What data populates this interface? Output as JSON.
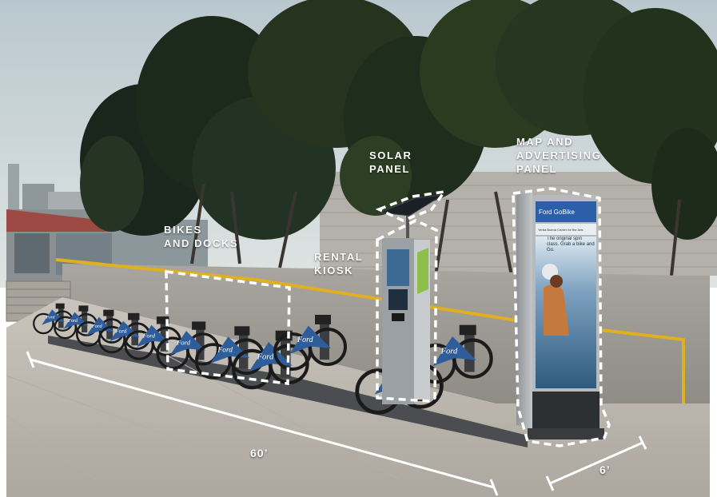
{
  "labels": {
    "bikes_docks": [
      "BIKES",
      "AND DOCKS"
    ],
    "rental_kiosk": [
      "RENTAL",
      "KIOSK"
    ],
    "solar_panel": [
      "SOLAR",
      "PANEL"
    ],
    "map_panel": [
      "MAP AND",
      "ADVERTISING",
      "PANEL"
    ]
  },
  "dimensions": {
    "length": "60’",
    "width": "6’"
  },
  "bike_brand": "Ford",
  "ad_panel": {
    "brand": "Ford GoBike",
    "subtitle": "Yerba Buena Center for the Arts",
    "headline": "The original spin class. Grab a bike and Go."
  },
  "colors": {
    "bike_blue": "#2f5d9a",
    "annotation": "#ffffff",
    "rail": "#e0b020"
  }
}
